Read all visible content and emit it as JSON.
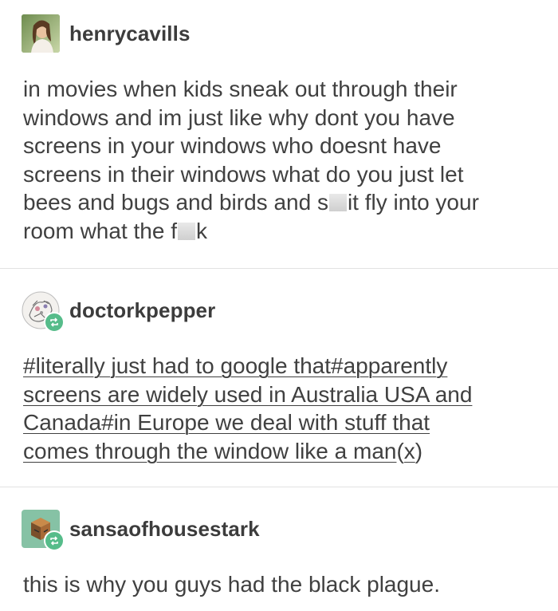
{
  "posts": [
    {
      "username": "henrycavills",
      "avatar_icon": "portrait-photo-icon",
      "lines": [
        "in movies when kids sneak out through their",
        "windows and im just like why dont you have",
        "screens in your windows who doesnt have",
        "screens in their windows what do you just let"
      ],
      "line5_a": "bees and bugs and birds and s",
      "line5_b": "it fly into your",
      "line6_a": "room what the f",
      "line6_b": "k"
    },
    {
      "username": "doctorkpepper",
      "avatar_icon": "illustration-avatar-icon",
      "badge_icon": "reblog-icon",
      "tags": [
        "#literally just had to google that",
        "#apparently screens are widely used in Australia USA and Canada",
        "#in Europe we deal with stuff that comes through the window like a man"
      ],
      "source_link": "(x)",
      "lines": [
        "#literally just had to google that#apparently",
        "screens are widely used in Australia USA and",
        "Canada#in Europe we deal with stuff that"
      ],
      "line4_a": "comes through the window like a man",
      "line4_b": "x"
    },
    {
      "username": "sansaofhousestark",
      "avatar_icon": "cube-avatar-icon",
      "badge_icon": "reblog-icon",
      "text": "this is why you guys had the black plague."
    }
  ],
  "colors": {
    "text": "#404040",
    "divider": "#e2e2e2",
    "reblog_badge": "#56bc8a"
  }
}
